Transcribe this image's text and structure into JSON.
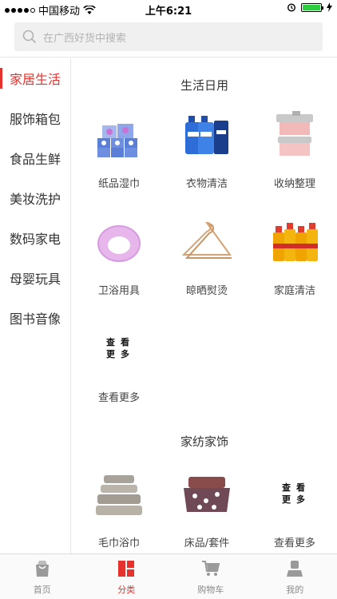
{
  "status_bar": {
    "carrier": "中国移动",
    "time": "上午6:21"
  },
  "search": {
    "placeholder": "在广西好货中搜索"
  },
  "sidebar": {
    "items": [
      {
        "label": "家居生活",
        "active": true
      },
      {
        "label": "服饰箱包",
        "active": false
      },
      {
        "label": "食品生鲜",
        "active": false
      },
      {
        "label": "美妆洗护",
        "active": false
      },
      {
        "label": "数码家电",
        "active": false
      },
      {
        "label": "母婴玩具",
        "active": false
      },
      {
        "label": "图书音像",
        "active": false
      }
    ]
  },
  "sections": [
    {
      "title": "生活日用",
      "items": [
        {
          "label": "纸品湿巾",
          "icon": "tissue-pack-icon"
        },
        {
          "label": "衣物清洁",
          "icon": "laundry-detergent-icon"
        },
        {
          "label": "收纳整理",
          "icon": "storage-box-icon"
        },
        {
          "label": "卫浴用具",
          "icon": "toilet-seat-cover-icon"
        },
        {
          "label": "晾晒熨烫",
          "icon": "clothes-hanger-icon"
        },
        {
          "label": "家庭清洁",
          "icon": "cleaner-bottles-icon"
        },
        {
          "label": "查看更多",
          "more_glyphs": [
            "查",
            "看",
            "更",
            "多"
          ]
        }
      ]
    },
    {
      "title": "家纺家饰",
      "items": [
        {
          "label": "毛巾浴巾",
          "icon": "towel-stack-icon"
        },
        {
          "label": "床品/套件",
          "icon": "bedding-set-icon"
        },
        {
          "label": "查看更多",
          "more_glyphs": [
            "查",
            "看",
            "更",
            "多"
          ]
        }
      ]
    }
  ],
  "tab_bar": {
    "tabs": [
      {
        "label": "首页",
        "icon": "shopping-bag-icon",
        "active": false
      },
      {
        "label": "分类",
        "icon": "category-grid-icon",
        "active": true
      },
      {
        "label": "购物车",
        "icon": "cart-icon",
        "active": false
      },
      {
        "label": "我的",
        "icon": "user-icon",
        "active": false
      }
    ]
  },
  "colors": {
    "accent": "#e5322d",
    "inactive": "#8a8a8a"
  }
}
